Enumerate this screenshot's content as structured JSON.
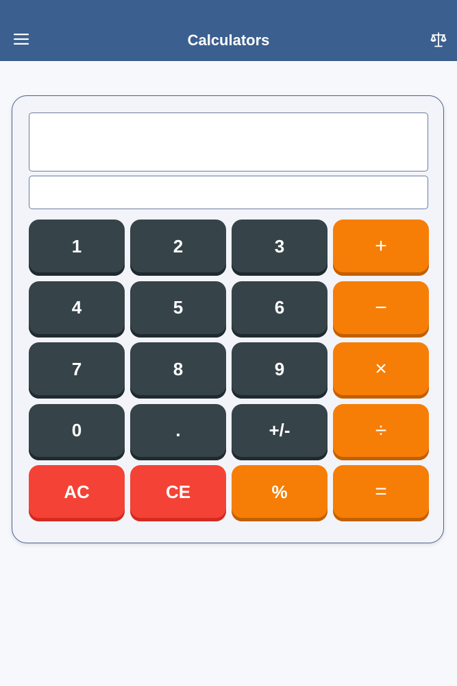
{
  "app_bar": {
    "title": "Calculators",
    "menu_icon": "hamburger-menu-icon",
    "right_icon": "scale-icon",
    "color": "#3b5f8e"
  },
  "display": {
    "expression": "",
    "result": ""
  },
  "keypad": {
    "keys": [
      {
        "label": "1",
        "kind": "num"
      },
      {
        "label": "2",
        "kind": "num"
      },
      {
        "label": "3",
        "kind": "num"
      },
      {
        "label": "+",
        "kind": "op"
      },
      {
        "label": "4",
        "kind": "num"
      },
      {
        "label": "5",
        "kind": "num"
      },
      {
        "label": "6",
        "kind": "num"
      },
      {
        "label": "−",
        "kind": "op"
      },
      {
        "label": "7",
        "kind": "num"
      },
      {
        "label": "8",
        "kind": "num"
      },
      {
        "label": "9",
        "kind": "num"
      },
      {
        "label": "×",
        "kind": "op"
      },
      {
        "label": "0",
        "kind": "num"
      },
      {
        "label": ".",
        "kind": "num"
      },
      {
        "label": "+/-",
        "kind": "num"
      },
      {
        "label": "÷",
        "kind": "op"
      },
      {
        "label": "AC",
        "kind": "clear"
      },
      {
        "label": "CE",
        "kind": "clear"
      },
      {
        "label": "%",
        "kind": "op"
      },
      {
        "label": "=",
        "kind": "op"
      }
    ]
  },
  "colors": {
    "number_key": "#364349",
    "operator_key": "#f67e06",
    "clear_key": "#f44336",
    "background": "#f7f8fc"
  }
}
